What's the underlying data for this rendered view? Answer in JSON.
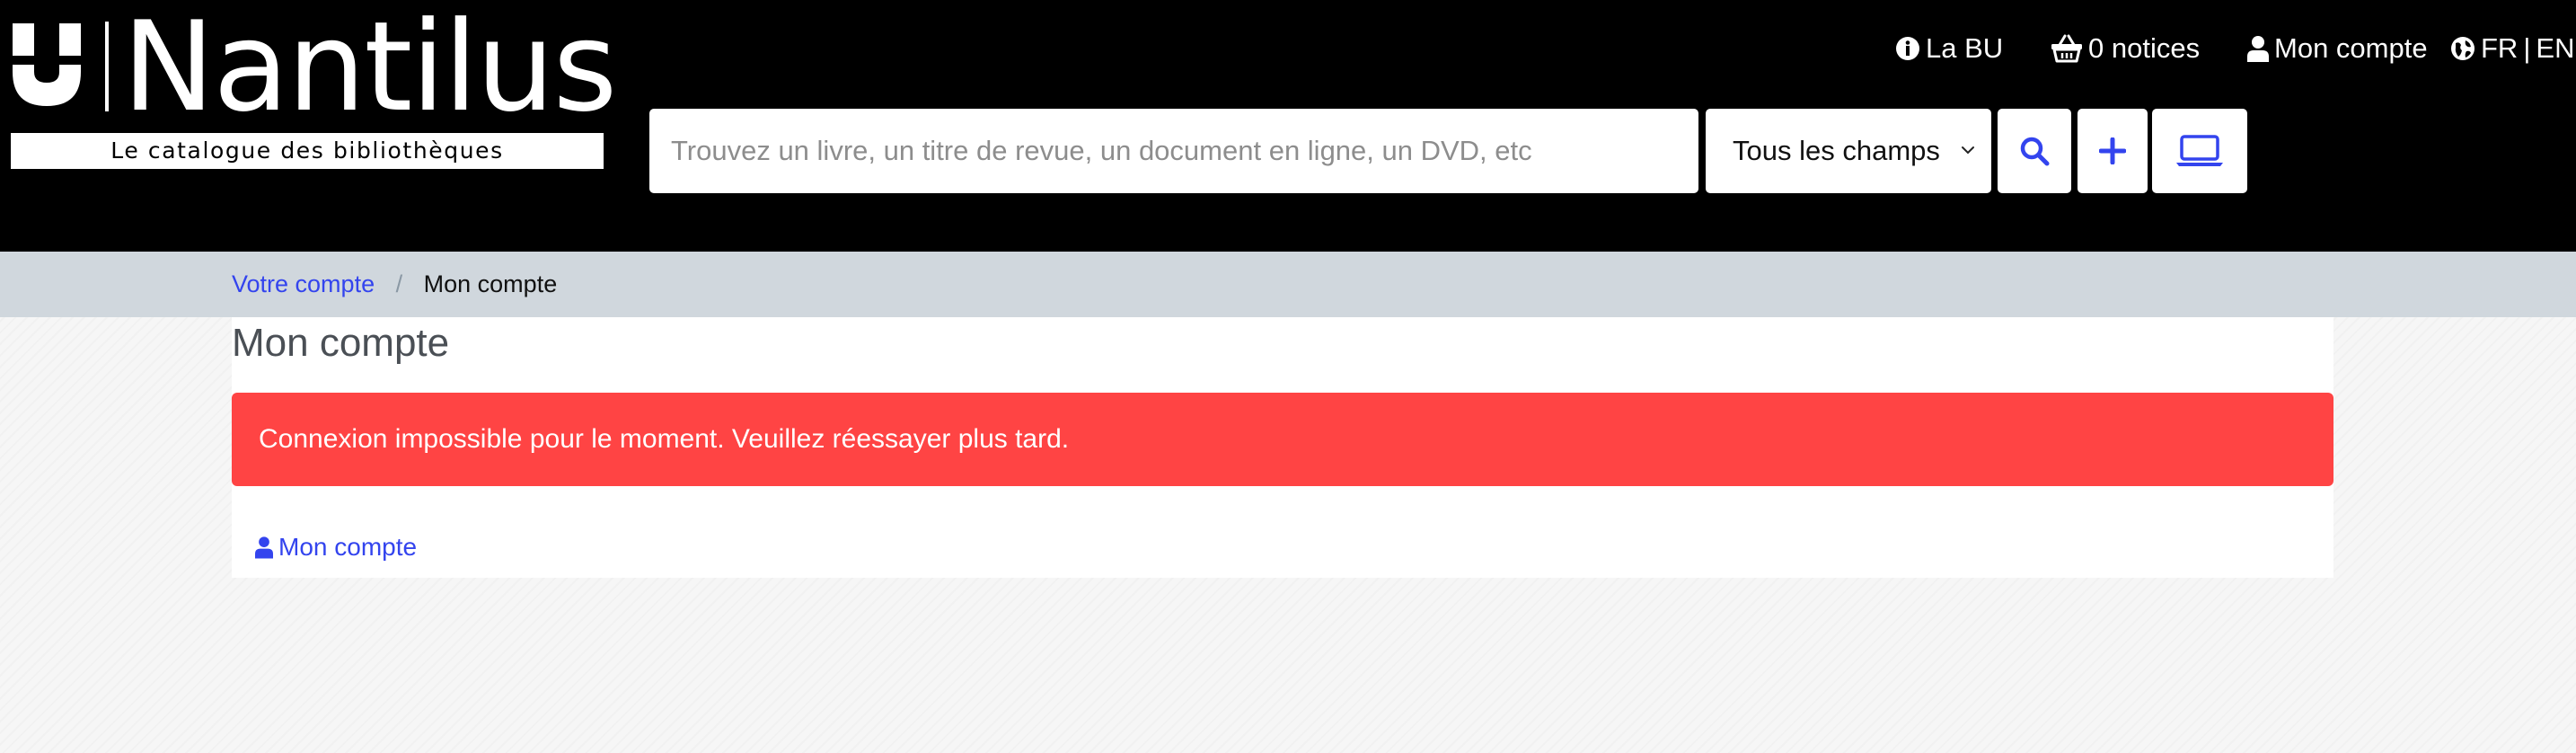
{
  "colors": {
    "header_bg": "#000000",
    "accent_blue": "#3344ee",
    "alert_red": "#ff4444",
    "breadcrumb_bg": "#d0d7dd"
  },
  "logo": {
    "name": "Nantilus",
    "tagline": "Le catalogue des bibliothèques"
  },
  "top_nav": {
    "labu": {
      "icon": "info-circle-icon",
      "label": "La BU"
    },
    "notices": {
      "icon": "basket-icon",
      "label": "0 notices"
    },
    "account": {
      "icon": "user-icon",
      "label": "Mon compte"
    },
    "language": {
      "icon": "globe-icon",
      "current": "FR",
      "separator": "|",
      "other": "EN"
    }
  },
  "search": {
    "placeholder": "Trouvez un livre, un titre de revue, un document en ligne, un DVD, etc",
    "value": "",
    "field_select": "Tous les champs",
    "buttons": [
      "search-icon",
      "plus-icon",
      "laptop-icon"
    ]
  },
  "breadcrumb": {
    "parent": "Votre compte",
    "separator": "/",
    "current": "Mon compte"
  },
  "main": {
    "title": "Mon compte",
    "alert": "Connexion impossible pour le moment. Veuillez réessayer plus tard.",
    "account_link": {
      "icon": "user-icon",
      "label": "Mon compte"
    }
  }
}
